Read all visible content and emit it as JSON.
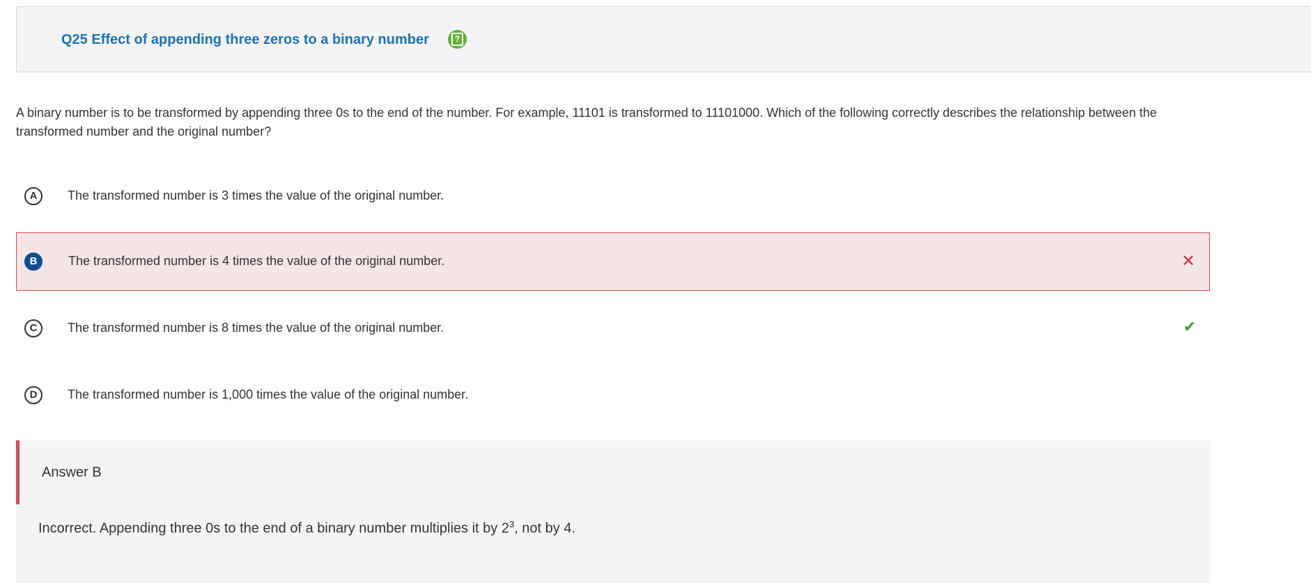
{
  "question": {
    "title": "Q25 Effect of appending three zeros to a binary number",
    "help_icon": "help-icon",
    "stem": "A binary number is to be transformed by appending three 0s to the end of the number. For example, 11101 is transformed to 11101000. Which of the following correctly describes the relationship between the transformed number and the original number?"
  },
  "choices": [
    {
      "letter": "A",
      "text": "The transformed number is 3 times the value of the original number.",
      "state": "none"
    },
    {
      "letter": "B",
      "text": "The transformed number is 4 times the value of the original number.",
      "state": "selected-incorrect",
      "mark": "✕"
    },
    {
      "letter": "C",
      "text": "The transformed number is 8 times the value of the original number.",
      "state": "correct",
      "mark": "✔"
    },
    {
      "letter": "D",
      "text": "The transformed number is 1,000 times the value of the original number.",
      "state": "none"
    }
  ],
  "answer": {
    "label": "Answer B",
    "explanation_before": "Incorrect. Appending three 0s to the end of a binary number multiplies it by 2",
    "explanation_exponent": "3",
    "explanation_after": ", not by 4."
  },
  "colors": {
    "title": "#1a73b8",
    "help_icon": "#5fb336",
    "incorrect": "#c8323f",
    "incorrect_bg": "#f4e5e6",
    "correct": "#3e9b3c",
    "selected_letter": "#0e4f94"
  }
}
